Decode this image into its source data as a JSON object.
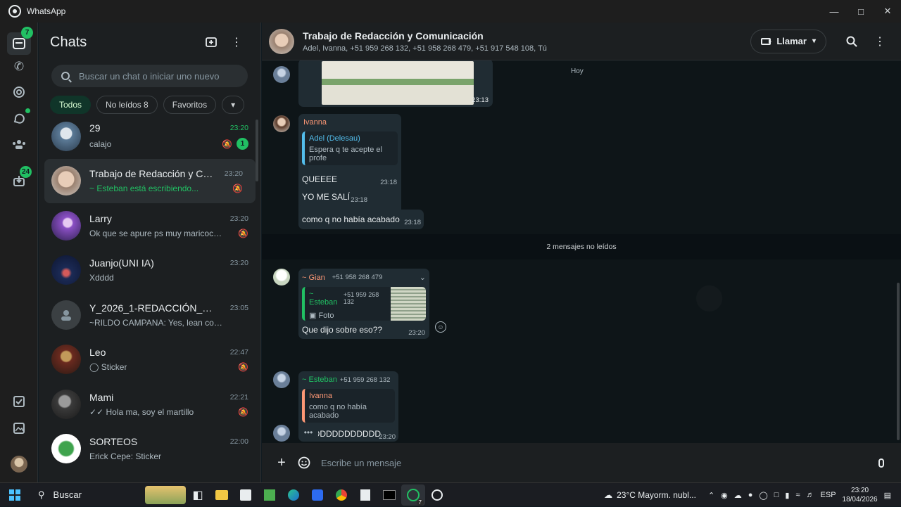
{
  "window": {
    "title": "WhatsApp",
    "controls": [
      "minimize-icon",
      "maximize-icon",
      "close-icon"
    ]
  },
  "rail": {
    "chats_badge": "7",
    "updates_badge": "24"
  },
  "sidebar": {
    "title": "Chats",
    "search_placeholder": "Buscar un chat o iniciar uno nuevo",
    "filters": [
      {
        "label": "Todos"
      },
      {
        "label": "No leídos 8"
      },
      {
        "label": "Favoritos"
      }
    ],
    "chats": [
      {
        "name": "29",
        "time": "23:20",
        "message": "calajo",
        "unread": "1"
      },
      {
        "name": "Trabajo de Redacción y Com...",
        "time": "23:20",
        "message": "~ Esteban está escribiendo..."
      },
      {
        "name": "Larry",
        "time": "23:20",
        "message": "Ok que se apure ps muy maricocin ..."
      },
      {
        "name": "Juanjo(UNI IA)",
        "time": "23:20",
        "message": "Xdddd"
      },
      {
        "name": "Y_2026_1-REDACCIÓN_UNI_...",
        "time": "23:05",
        "message": "~RILDO CAMPANA: Yes, lean con aten..."
      },
      {
        "name": "Leo",
        "time": "22:47",
        "message": "Sticker"
      },
      {
        "name": "Mami",
        "time": "22:21",
        "message": "Hola ma, soy el martillo"
      },
      {
        "name": "SORTEOS",
        "time": "22:00",
        "message": "Erick Cepe: Sticker"
      }
    ]
  },
  "chat": {
    "title": "Trabajo de Redacción y Comunicación",
    "participants": "Adel, Ivanna, +51 959 268 132, +51 958 268 479, +51 917 548 108, Tú",
    "call_label": "Llamar",
    "day_label": "Hoy",
    "image_time": "23:13",
    "unread_divider": "2 mensajes no leídos",
    "ivanna": {
      "sender": "Ivanna",
      "quote_author": "Adel (Delesau)",
      "quote_text": "Espera q te acepte el profe",
      "m1": "QUEEEE",
      "t1": "23:18",
      "m2": "YO ME SALÍ",
      "t2": "23:18",
      "m3": "como q no había acabado",
      "t3": "23:18"
    },
    "gian": {
      "sender": "~ Gian",
      "phone": "+51 958 268 479",
      "quote_author": "~ Esteban",
      "quote_phone": "+51 959 268 132",
      "quote_text": "Foto",
      "message": "Que dijo sobre eso??",
      "time": "23:20"
    },
    "esteban": {
      "sender": "~ Esteban",
      "phone": "+51 959 268 132",
      "quote_author": "Ivanna",
      "quote_text": "como q no había acabado",
      "message": "XDDDDDDDDDDDD",
      "time": "23:20"
    },
    "typing": "•••",
    "composer_placeholder": "Escribe un mensaje"
  },
  "taskbar": {
    "search_label": "Buscar",
    "weather": "23°C  Mayorm. nubl...",
    "lang": "ESP",
    "time": "23:20",
    "date": "18/04/2026",
    "whatsapp_badge": "7"
  },
  "colors": {
    "accent": "#21c063",
    "bubble": "#202c33",
    "panel": "#1c1f21"
  }
}
